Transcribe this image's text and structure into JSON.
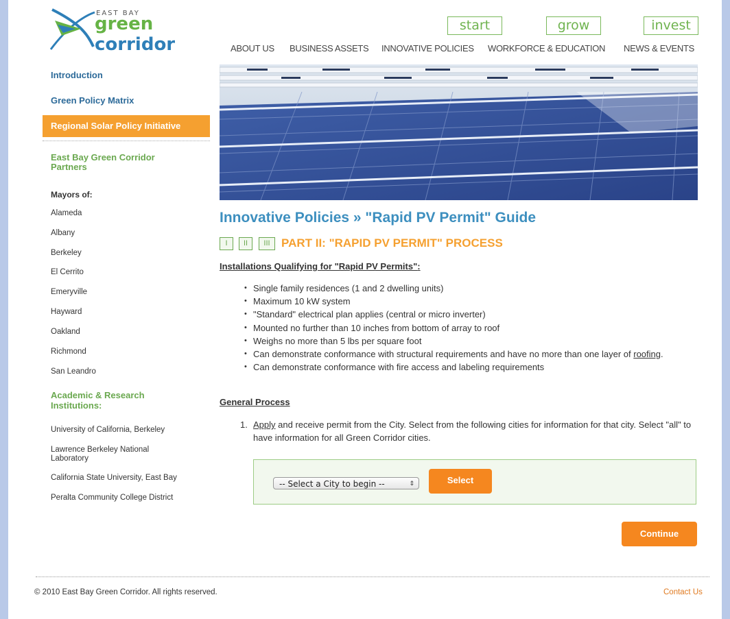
{
  "logo": {
    "small_text": "EAST BAY",
    "word_green": "green",
    "word_blue": "corridor"
  },
  "top_buttons": [
    "start",
    "grow",
    "invest"
  ],
  "nav": [
    "ABOUT US",
    "BUSINESS ASSETS",
    "INNOVATIVE POLICIES",
    "WORKFORCE & EDUCATION",
    "NEWS & EVENTS"
  ],
  "sidebar": {
    "introduction": "Introduction",
    "green_policy_matrix": "Green Policy Matrix",
    "regional_solar": "Regional Solar Policy Initiative",
    "partners": "East Bay Green Corridor Partners",
    "mayors_heading": "Mayors of:",
    "mayors": [
      "Alameda",
      "Albany",
      "Berkeley",
      "El Cerrito",
      "Emeryville",
      "Hayward",
      "Oakland",
      "Richmond",
      "San Leandro"
    ],
    "academic_heading": "Academic & Research Institutions:",
    "institutions": [
      "University of California, Berkeley",
      "Lawrence Berkeley National Laboratory",
      "California State University, East Bay",
      "Peralta Community College District"
    ]
  },
  "main": {
    "title": "Innovative Policies » \"Rapid PV Permit\" Guide",
    "part_tabs": [
      "I",
      "II",
      "III"
    ],
    "part_title": "PART II: \"RAPID PV PERMIT\" PROCESS",
    "qualifying_heading": "Installations Qualifying for \"Rapid PV Permits\"",
    "qualifying_colon": ":",
    "bullets": [
      "Single family residences (1 and 2 dwelling units)",
      "Maximum 10 kW system",
      "\"Standard\" electrical plan applies (central or micro inverter)",
      "Mounted no further than 10 inches from bottom of array to roof",
      "Weighs no more than 5 lbs per square foot"
    ],
    "bullet_structural_a": "Can demonstrate conformance with structural requirements and have no more than one layer of ",
    "bullet_structural_link": "roofing",
    "bullet_structural_b": ".",
    "bullet_fire": "Can demonstrate conformance with fire access and labeling requirements",
    "general_heading": "General Process",
    "step_number": "1.",
    "step_link": "Apply",
    "step_text": " and receive permit from the City.  Select from the following cities for information for that city. Select \"all\" to have information for all Green Corridor cities.",
    "city_select_value": "-- Select a City to begin --",
    "select_button": "Select",
    "continue_button": "Continue"
  },
  "footer": {
    "copyright": "© 2010 East Bay Green Corridor. All rights reserved.",
    "contact": "Contact Us"
  },
  "colors": {
    "accent_orange": "#f5871f",
    "heading_blue": "#3d8fbf",
    "brand_green": "#6aa84f"
  }
}
